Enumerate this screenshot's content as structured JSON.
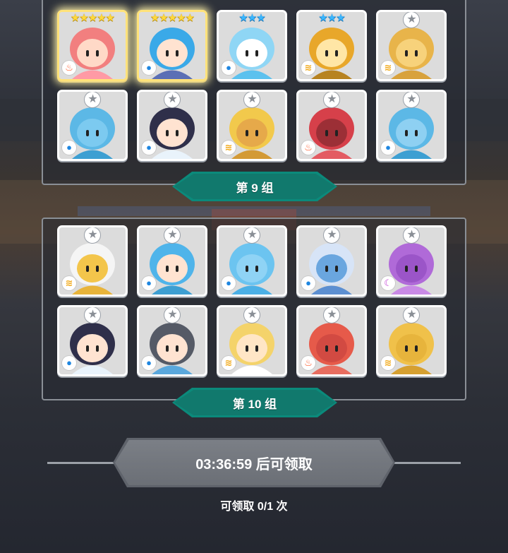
{
  "groups": [
    {
      "label": "第 9 组",
      "heroes": [
        {
          "stars": "★★★★★",
          "star_type": "gold",
          "element": "fire",
          "element_icon": "fire-icon",
          "highlight": true,
          "hair": "#f27f7f",
          "skin": "#ffd9c7",
          "outfit": "#ff9aa5"
        },
        {
          "stars": "★★★★★",
          "star_type": "gold",
          "element": "water",
          "element_icon": "water-drop-icon",
          "highlight": true,
          "hair": "#3aa9e8",
          "skin": "#ffe3d1",
          "outfit": "#5b6fb5"
        },
        {
          "stars": "★★★",
          "star_type": "blue",
          "element": "water",
          "element_icon": "water-drop-icon",
          "highlight": false,
          "hair": "#8fd6f5",
          "skin": "#ffffff",
          "outfit": "#5cc1ee"
        },
        {
          "stars": "★★★",
          "star_type": "blue",
          "element": "wind",
          "element_icon": "wind-icon",
          "highlight": false,
          "hair": "#e8a72a",
          "skin": "#ffe6a6",
          "outfit": "#b78321"
        },
        {
          "stars": "★",
          "star_type": "gray",
          "element": "wind",
          "element_icon": "wind-icon",
          "highlight": false,
          "hair": "#e8b44a",
          "skin": "#f7d27b",
          "outfit": "#d8a23d"
        },
        {
          "stars": "★",
          "star_type": "gray",
          "element": "water",
          "element_icon": "water-drop-icon",
          "highlight": false,
          "hair": "#5cb8e6",
          "skin": "#7ccaf0",
          "outfit": "#3d9fd2"
        },
        {
          "stars": "★",
          "star_type": "gray",
          "element": "water",
          "element_icon": "water-drop-icon",
          "highlight": false,
          "hair": "#2f2f4a",
          "skin": "#ffe3d1",
          "outfit": "#e9f3fb"
        },
        {
          "stars": "★",
          "star_type": "gray",
          "element": "wind",
          "element_icon": "wind-icon",
          "highlight": false,
          "hair": "#f2c94c",
          "skin": "#e6a94a",
          "outfit": "#d39a36"
        },
        {
          "stars": "★",
          "star_type": "gray",
          "element": "fire",
          "element_icon": "fire-icon",
          "highlight": false,
          "hair": "#d6404a",
          "skin": "#9c2f36",
          "outfit": "#e35b62"
        },
        {
          "stars": "★",
          "star_type": "gray",
          "element": "water",
          "element_icon": "water-drop-icon",
          "highlight": false,
          "hair": "#5cb8e6",
          "skin": "#8ed0f2",
          "outfit": "#3d9fd2"
        }
      ]
    },
    {
      "label": "第 10 组",
      "heroes": [
        {
          "stars": "★",
          "star_type": "gray",
          "element": "wind",
          "element_icon": "wind-icon",
          "highlight": false,
          "hair": "#f5f5f5",
          "skin": "#f3c54b",
          "outfit": "#e8b43a"
        },
        {
          "stars": "★",
          "star_type": "gray",
          "element": "water",
          "element_icon": "water-drop-icon",
          "highlight": false,
          "hair": "#4fb4ea",
          "skin": "#ffe3d1",
          "outfit": "#3d9fd2"
        },
        {
          "stars": "★",
          "star_type": "gray",
          "element": "water",
          "element_icon": "water-drop-icon",
          "highlight": false,
          "hair": "#6cc4f0",
          "skin": "#8fd3f5",
          "outfit": "#4bb0e6"
        },
        {
          "stars": "★",
          "star_type": "gray",
          "element": "water",
          "element_icon": "water-drop-icon",
          "highlight": false,
          "hair": "#d7e4f7",
          "skin": "#6aa6df",
          "outfit": "#5c8fd1"
        },
        {
          "stars": "★",
          "star_type": "gray",
          "element": "dark",
          "element_icon": "moon-icon",
          "highlight": false,
          "hair": "#b06ad8",
          "skin": "#9b55c8",
          "outfit": "#c98ae6"
        },
        {
          "stars": "★",
          "star_type": "gray",
          "element": "water",
          "element_icon": "water-drop-icon",
          "highlight": false,
          "hair": "#2f2f4a",
          "skin": "#ffe3d1",
          "outfit": "#e9f3fb"
        },
        {
          "stars": "★",
          "star_type": "gray",
          "element": "water",
          "element_icon": "water-drop-icon",
          "highlight": false,
          "hair": "#555a66",
          "skin": "#ffe3d1",
          "outfit": "#5aa8dd"
        },
        {
          "stars": "★",
          "star_type": "gray",
          "element": "wind",
          "element_icon": "wind-icon",
          "highlight": false,
          "hair": "#f4d36a",
          "skin": "#ffe6c6",
          "outfit": "#ffffff"
        },
        {
          "stars": "★",
          "star_type": "gray",
          "element": "fire",
          "element_icon": "fire-icon",
          "highlight": false,
          "hair": "#e65a4a",
          "skin": "#d24a42",
          "outfit": "#e86d5f"
        },
        {
          "stars": "★",
          "star_type": "gray",
          "element": "wind",
          "element_icon": "wind-icon",
          "highlight": false,
          "hair": "#f0c14a",
          "skin": "#e7b43c",
          "outfit": "#d6a030"
        }
      ]
    }
  ],
  "element_glyphs": {
    "fire": "♨",
    "water": "●",
    "wind": "≋",
    "dark": "☾"
  },
  "footer": {
    "timer_text": "03:36:59 后可领取",
    "claim_text": "可领取 0/1 次"
  },
  "colors": {
    "label_bg": "#0b8a7b",
    "gold_star": "#ffd93b",
    "blue_star": "#39b6ff"
  }
}
